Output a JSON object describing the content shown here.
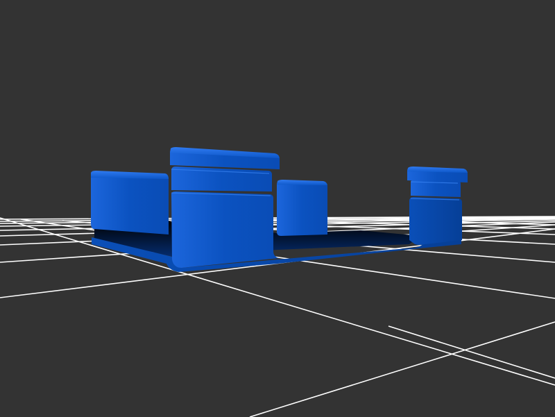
{
  "viewport": {
    "background_color": "#333333"
  },
  "ground_grid": {
    "line_color": "#ffffff",
    "visible": true
  },
  "model": {
    "color_light": "#1e6be6",
    "color_mid": "#0a52c2",
    "color_dark": "#043a91",
    "color_shadow": "#020f26"
  }
}
